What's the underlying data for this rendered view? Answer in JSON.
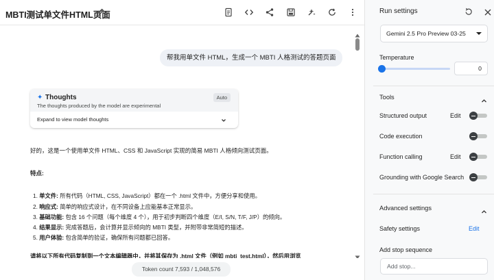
{
  "header": {
    "title": "MBTI测试单文件HTML页面",
    "icons": [
      "edit-icon",
      "document-icon",
      "code-icon",
      "share-icon",
      "save-icon",
      "compare-icon",
      "refresh-icon",
      "more-icon"
    ]
  },
  "chat": {
    "user_message": "帮我用单文件 HTML，生成一个 MBTI 人格测试的答题页面",
    "thoughts": {
      "title": "Thoughts",
      "subtitle": "The thoughts produced by the model are experimental",
      "badge": "Auto",
      "expand_label": "Expand to view model thoughts"
    },
    "response": {
      "intro": "好的，这是一个使用单文件 HTML、CSS 和 JavaScript 实现的简易 MBTI 人格倾向测试页面。",
      "features_heading": "特点:",
      "features": [
        {
          "num": "1.",
          "label": "单文件:",
          "text": " 所有代码（HTML, CSS, JavaScript）都在一个 .html 文件中，方便分享和使用。"
        },
        {
          "num": "2.",
          "label": "响应式:",
          "text": " 简单的响应式设计，在不同设备上应能基本正常显示。"
        },
        {
          "num": "3.",
          "label": "基础功能:",
          "text": " 包含 16 个问题（每个维度 4 个），用于初步判断四个维度（E/I, S/N, T/F, J/P）的倾向。"
        },
        {
          "num": "4.",
          "label": "结果显示:",
          "text": " 完成答题后，会计算并显示倾向的 MBTI 类型，并附带非常简短的描述。"
        },
        {
          "num": "5.",
          "label": "用户体验:",
          "text": " 包含简单的验证，确保所有问题都已回答。"
        }
      ],
      "cut_line": "请将以下所有代码复制到一个文本编辑器中，并将其保存为 .html 文件（例如 mbti_test.html），然后用浏览"
    },
    "token_count": "Token count 7,593 / 1,048,576"
  },
  "settings": {
    "title": "Run settings",
    "model": "Gemini 2.5 Pro Preview 03-25",
    "temperature_label": "Temperature",
    "temperature_value": "0",
    "temperature_fraction": 0,
    "tools_title": "Tools",
    "tools": [
      {
        "label": "Structured output",
        "edit": "Edit",
        "enabled": false
      },
      {
        "label": "Code execution",
        "edit": "",
        "enabled": false
      },
      {
        "label": "Function calling",
        "edit": "Edit",
        "enabled": false
      },
      {
        "label": "Grounding with Google Search",
        "edit": "",
        "enabled": false
      }
    ],
    "advanced_title": "Advanced settings",
    "safety_label": "Safety settings",
    "safety_edit": "Edit",
    "stop_label": "Add stop sequence",
    "stop_placeholder": "Add stop..."
  },
  "colors": {
    "accent": "#1a73e8",
    "user_bubble": "#eef1f6",
    "panel_bg": "#f8f9fa"
  }
}
